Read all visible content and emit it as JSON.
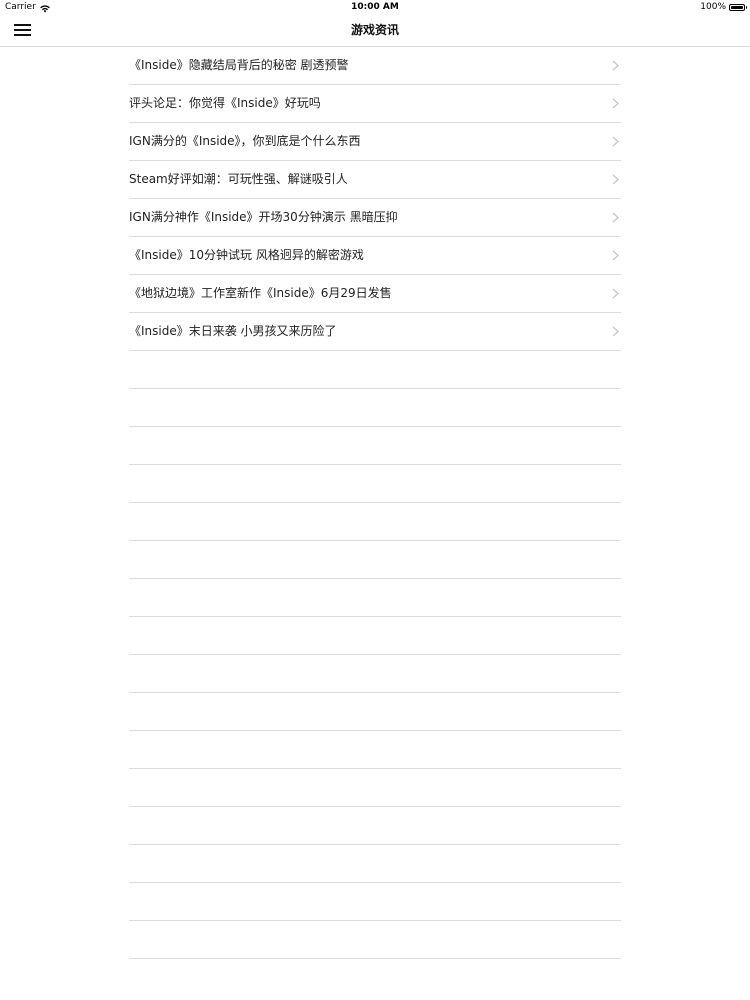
{
  "status_bar": {
    "carrier": "Carrier",
    "wifi_icon": "wifi-icon",
    "time": "10:00 AM",
    "battery": "100%",
    "battery_icon": "battery-icon"
  },
  "nav_bar": {
    "menu_icon": "hamburger-menu-icon",
    "title": "游戏资讯"
  },
  "news_list": {
    "items": [
      {
        "title": "《Inside》隐藏结局背后的秘密 剧透预警"
      },
      {
        "title": "评头论足：你觉得《Inside》好玩吗"
      },
      {
        "title": "IGN满分的《Inside》，你到底是个什么东西"
      },
      {
        "title": "Steam好评如潮：可玩性强、解谜吸引人"
      },
      {
        "title": "IGN满分神作《Inside》开场30分钟演示 黑暗压抑"
      },
      {
        "title": "《Inside》10分钟试玩 风格迥异的解密游戏"
      },
      {
        "title": "《地狱边境》工作室新作《Inside》6月29日发售"
      },
      {
        "title": "《Inside》末日来袭 小男孩又来历险了"
      }
    ],
    "chevron_icon": "chevron-right-icon",
    "chevron_color": "#c7c7cc",
    "separator_color": "#dcdcdc"
  }
}
